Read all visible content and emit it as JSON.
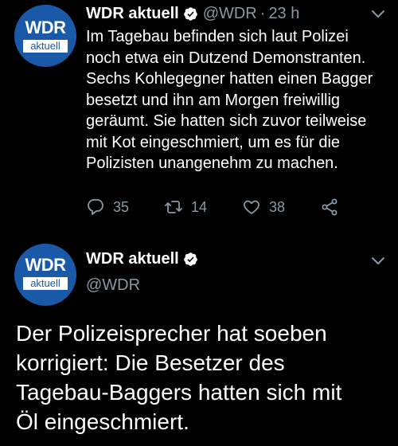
{
  "colors": {
    "background": "#000000",
    "text": "#ffffff",
    "muted": "#8899a6",
    "verified": "#ffffff",
    "brand_blue": "#1a58a8"
  },
  "tweet": {
    "avatar": {
      "logo_top": "WDR",
      "logo_bottom": "aktuell",
      "icon": "wdr-aktuell-logo"
    },
    "display_name": "WDR aktuell",
    "handle": "@WDR",
    "separator": "·",
    "timestamp": "23 h",
    "text": "Im Tagebau befinden sich laut Polizei\nnoch etwa ein Dutzend Demonstranten.\nSechs Kohlegegner hatten einen Bagger\nbesetzt und ihn am Morgen freiwillig\ngeräumt. Sie hatten sich zuvor teilweise\nmit Kot eingeschmiert, um es für die\nPolizisten unangenehm zu machen.",
    "actions": {
      "reply_count": "35",
      "retweet_count": "14",
      "like_count": "38",
      "icons": [
        "reply-icon",
        "retweet-icon",
        "like-icon",
        "share-icon"
      ]
    }
  },
  "quoted_tweet": {
    "avatar": {
      "logo_top": "WDR",
      "logo_bottom": "aktuell",
      "icon": "wdr-aktuell-logo"
    },
    "display_name": "WDR aktuell",
    "handle": "@WDR",
    "text": "Der Polizeisprecher hat soeben\nkorrigiert: Die Besetzer des\nTagebau-Baggers hatten sich mit\nÖl eingeschmiert."
  }
}
